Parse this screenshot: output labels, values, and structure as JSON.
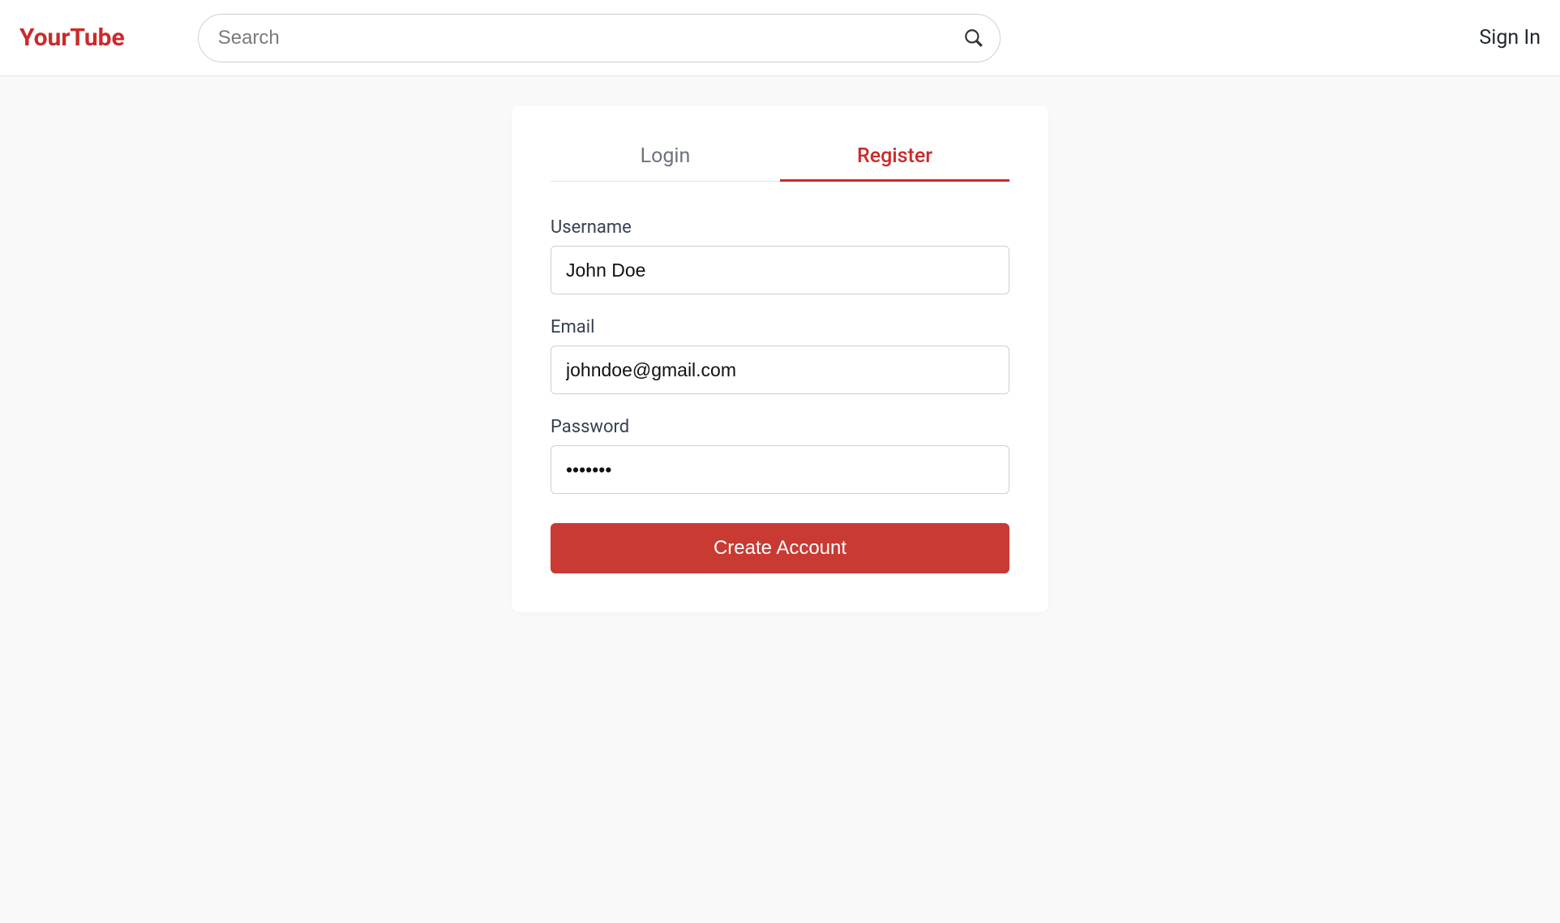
{
  "header": {
    "logo": "YourTube",
    "search_placeholder": "Search",
    "signin_label": "Sign In"
  },
  "auth": {
    "tabs": {
      "login": "Login",
      "register": "Register"
    },
    "fields": {
      "username_label": "Username",
      "username_value": "John Doe",
      "email_label": "Email",
      "email_value": "johndoe@gmail.com",
      "password_label": "Password",
      "password_value": "1234567"
    },
    "submit_label": "Create Account"
  }
}
